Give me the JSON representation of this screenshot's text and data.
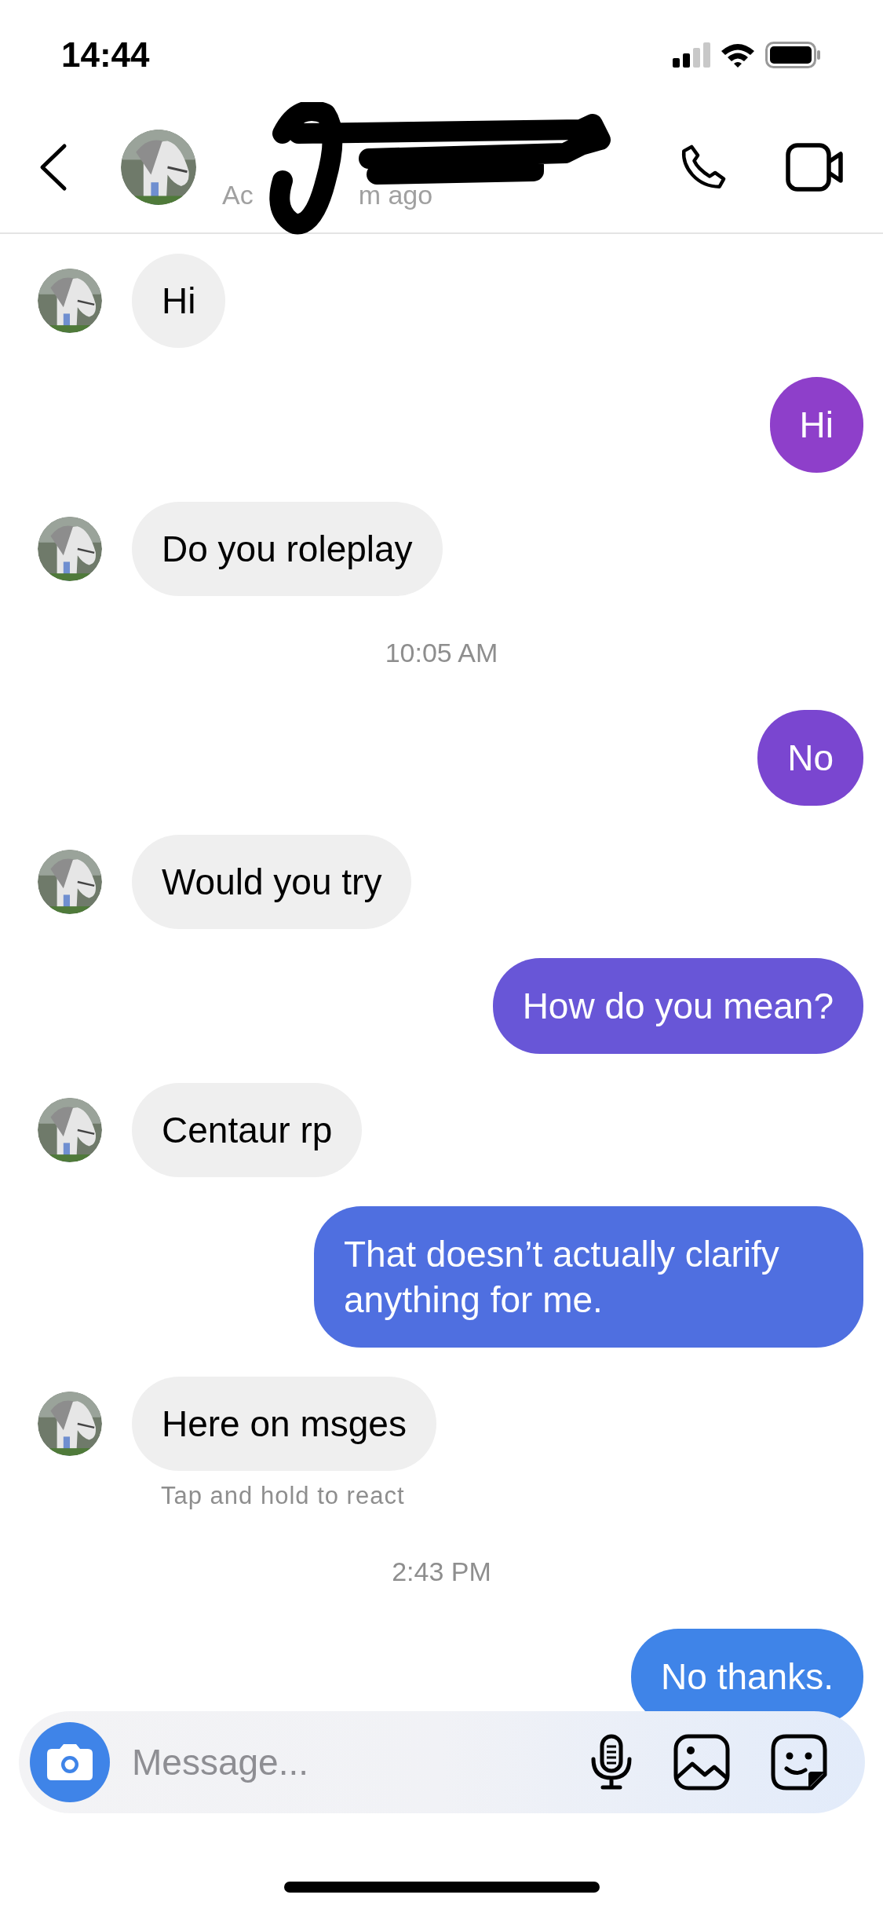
{
  "status_bar": {
    "time": "14:44"
  },
  "header": {
    "subtitle_parts": [
      "Ac",
      "m ago"
    ]
  },
  "messages": [
    {
      "kind": "incoming",
      "text": "Hi"
    },
    {
      "kind": "outgoing",
      "text": "Hi"
    },
    {
      "kind": "incoming",
      "text": "Do you roleplay"
    },
    {
      "kind": "timestamp",
      "text": "10:05 AM"
    },
    {
      "kind": "outgoing",
      "text": "No"
    },
    {
      "kind": "incoming",
      "text": "Would you try"
    },
    {
      "kind": "outgoing",
      "text": "How do you mean?"
    },
    {
      "kind": "incoming",
      "text": "Centaur rp"
    },
    {
      "kind": "outgoing",
      "text": "That doesn’t actually clarify anything for me."
    },
    {
      "kind": "incoming",
      "text": "Here on msges"
    },
    {
      "kind": "hint",
      "text": "Tap and hold to react"
    },
    {
      "kind": "timestamp",
      "text": "2:43 PM"
    },
    {
      "kind": "outgoing",
      "text": "No thanks."
    }
  ],
  "composer": {
    "placeholder": "Message..."
  }
}
